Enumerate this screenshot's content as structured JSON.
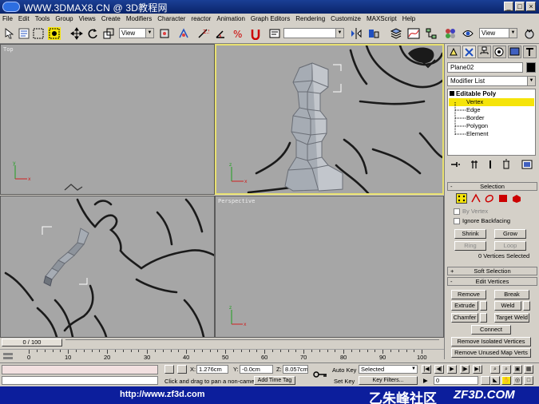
{
  "window": {
    "title": "WWW.3DMAX8.CN @ 3D教程网",
    "controls": [
      "_",
      "□",
      "×"
    ]
  },
  "menu": [
    "File",
    "Edit",
    "Tools",
    "Group",
    "Views",
    "Create",
    "Modifiers",
    "Character",
    "reactor",
    "Animation",
    "Graph Editors",
    "Rendering",
    "Customize",
    "MAXScript",
    "Help"
  ],
  "toolbar": {
    "ref_coord_value": "View",
    "named_selection_value": "",
    "render_view_value": "View"
  },
  "viewports": {
    "top": {
      "label": "Top"
    },
    "front": {
      "label": ""
    },
    "left": {
      "label": ""
    },
    "perspective": {
      "label": "Perspective"
    }
  },
  "command_panel": {
    "object_name": "Plane02",
    "object_color": "#000000",
    "modifier_list_label": "Modifier List",
    "stack": [
      {
        "label": "Editable Poly",
        "level": 0,
        "selected": false
      },
      {
        "label": "Vertex",
        "level": 1,
        "selected": true
      },
      {
        "label": "Edge",
        "level": 1,
        "selected": false
      },
      {
        "label": "Border",
        "level": 1,
        "selected": false
      },
      {
        "label": "Polygon",
        "level": 1,
        "selected": false
      },
      {
        "label": "Element",
        "level": 1,
        "selected": false
      }
    ],
    "selection_rollout": {
      "title": "Selection",
      "by_vertex": "By Vertex",
      "ignore_backfacing": "Ignore Backfacing",
      "shrink": "Shrink",
      "grow": "Grow",
      "ring": "Ring",
      "loop": "Loop",
      "status": "0 Vertices Selected"
    },
    "soft_selection_rollout": {
      "title": "Soft Selection"
    },
    "edit_vertices_rollout": {
      "title": "Edit Vertices",
      "remove": "Remove",
      "break": "Break",
      "extrude": "Extrude",
      "weld": "Weld",
      "chamfer": "Chamfer",
      "target_weld": "Target Weld",
      "connect": "Connect",
      "remove_isolated": "Remove Isolated Vertices",
      "remove_unused": "Remove Unused Map Verts"
    },
    "colors": {
      "selected_stack_item": "#f5e40a",
      "vertex_mode": "#f5e40a"
    }
  },
  "time_slider": {
    "value": "0 / 100"
  },
  "track": {
    "ticks": [
      "0",
      "10",
      "20",
      "30",
      "40",
      "50",
      "60",
      "70",
      "80",
      "90",
      "100"
    ]
  },
  "status": {
    "prompt": "Click and drag to pan a non-camera",
    "add_time_tag": "Add Time Tag",
    "x_label": "X:",
    "x_value": "1.276cm",
    "y_label": "Y:",
    "y_value": "-0.0cm",
    "z_label": "Z:",
    "z_value": "8.057cm",
    "auto_key": "Auto Key",
    "set_key": "Set Key",
    "key_set_value": "Selected",
    "key_filters": "Key Filters...",
    "frame_value": "0"
  },
  "banner": {
    "url": "http://www.zf3d.com",
    "chinese": "乙朱峰社区",
    "site": "ZF3D.COM"
  }
}
